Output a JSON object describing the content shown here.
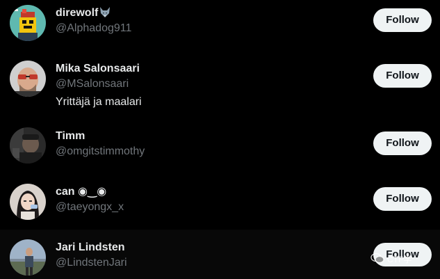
{
  "users": [
    {
      "name": "direwolf",
      "name_emoji": "wolf-icon",
      "handle": "@Alphadog911",
      "bio": "",
      "follow_label": "Follow"
    },
    {
      "name": "Mika Salonsaari",
      "handle": "@MSalonsaari",
      "bio": "Yrittäjä ja maalari",
      "follow_label": "Follow"
    },
    {
      "name": "Timm",
      "handle": "@omgitstimmothy",
      "bio": "",
      "follow_label": "Follow"
    },
    {
      "name": "can ◉‿◉",
      "handle": "@taeyongx_x",
      "bio": "",
      "follow_label": "Follow"
    },
    {
      "name": "Jari Lindsten",
      "handle": "@LindstenJari",
      "bio": "",
      "follow_label": "Follow"
    }
  ],
  "watermark": {
    "icon": "wechat-icon",
    "text": "CTF学"
  },
  "colors": {
    "background": "#000000",
    "name": "#e7e9ea",
    "handle": "#71767b",
    "follow_bg": "#eff3f4",
    "follow_text": "#0f1419"
  }
}
